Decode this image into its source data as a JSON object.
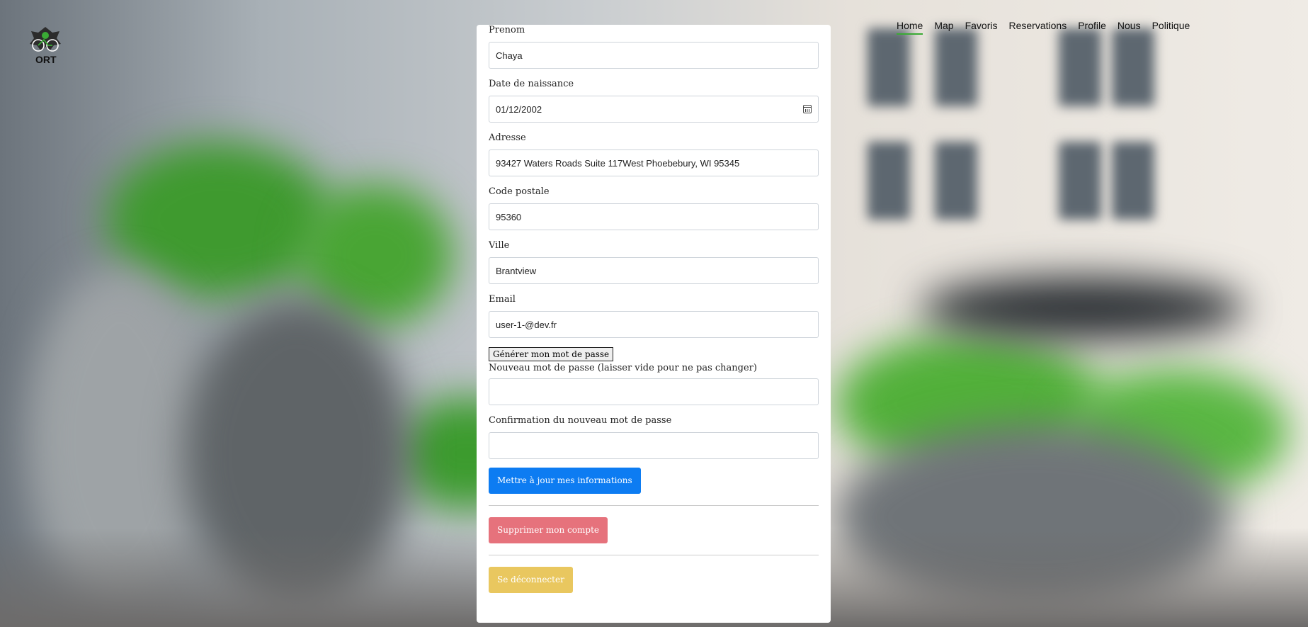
{
  "brand": {
    "logo_text": "ORT"
  },
  "nav": {
    "items": [
      "Home",
      "Map",
      "Favoris",
      "Reservations",
      "Profile",
      "Nous",
      "Politique"
    ],
    "active": "Home"
  },
  "form": {
    "prenom": {
      "label": "Prenom",
      "value": "Chaya"
    },
    "naissance": {
      "label": "Date de naissance",
      "value": "01/12/2002"
    },
    "adresse": {
      "label": "Adresse",
      "value": "93427 Waters Roads Suite 117West Phoebebury, WI 95345"
    },
    "code_postal": {
      "label": "Code postale",
      "value": "95360"
    },
    "ville": {
      "label": "Ville",
      "value": "Brantview"
    },
    "email": {
      "label": "Email",
      "value": "user-1-@dev.fr"
    },
    "generate_label": "Générer mon mot de passe",
    "new_password": {
      "label": "Nouveau mot de passe (laisser vide pour ne pas changer)",
      "value": ""
    },
    "confirm_password": {
      "label": "Confirmation du nouveau mot de passe",
      "value": ""
    },
    "update_label": "Mettre à jour mes informations",
    "delete_label": "Supprimer mon compte",
    "logout_label": "Se déconnecter"
  },
  "colors": {
    "primary": "#0d7cf2",
    "danger": "#e6727c",
    "warning": "#e9c75f",
    "nav_active": "#3aaa35"
  }
}
